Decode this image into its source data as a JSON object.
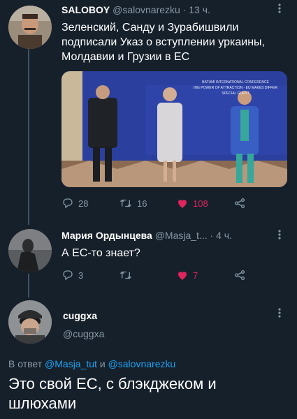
{
  "tweet1": {
    "display_name": "SALOBOY",
    "handle": "@salovnarezku",
    "time": "· 13 ч.",
    "text": "Зеленский, Санду и Зурабишвили подписали Указ о вступлении уркаины, Молдавии и Грузии в ЕС",
    "media": {
      "banner_line1": "BATUMI INTERNATIONAL CONFERENCE",
      "banner_line2": "ING POWER OF ATTRACTION - EU MAKES DIFFER",
      "banner_line3": "SPECIAL GUEST"
    },
    "replies": "28",
    "retweets": "16",
    "likes": "108"
  },
  "tweet2": {
    "display_name": "Мария Ордынцева",
    "handle": "@Masja_t...",
    "time": "· 4 ч.",
    "text": "А ЕС-то знает?",
    "replies": "3",
    "retweets": "",
    "likes": "7"
  },
  "tweet3": {
    "display_name": "cuggxa",
    "handle": "@cuggxa",
    "reply_prefix": "В ответ",
    "reply_user1": "@Masja_tut",
    "reply_and": "и",
    "reply_user2": "@salovnarezku",
    "text": "Это свой ЕС, с блэкджеком и шлюхами"
  },
  "colors": {
    "background": "#16202b",
    "secondary_text": "#8899a6",
    "link": "#1da1f2",
    "like": "#e0245e"
  },
  "icons": [
    "reply-icon",
    "retweet-icon",
    "heart-icon",
    "share-icon",
    "more-icon"
  ]
}
